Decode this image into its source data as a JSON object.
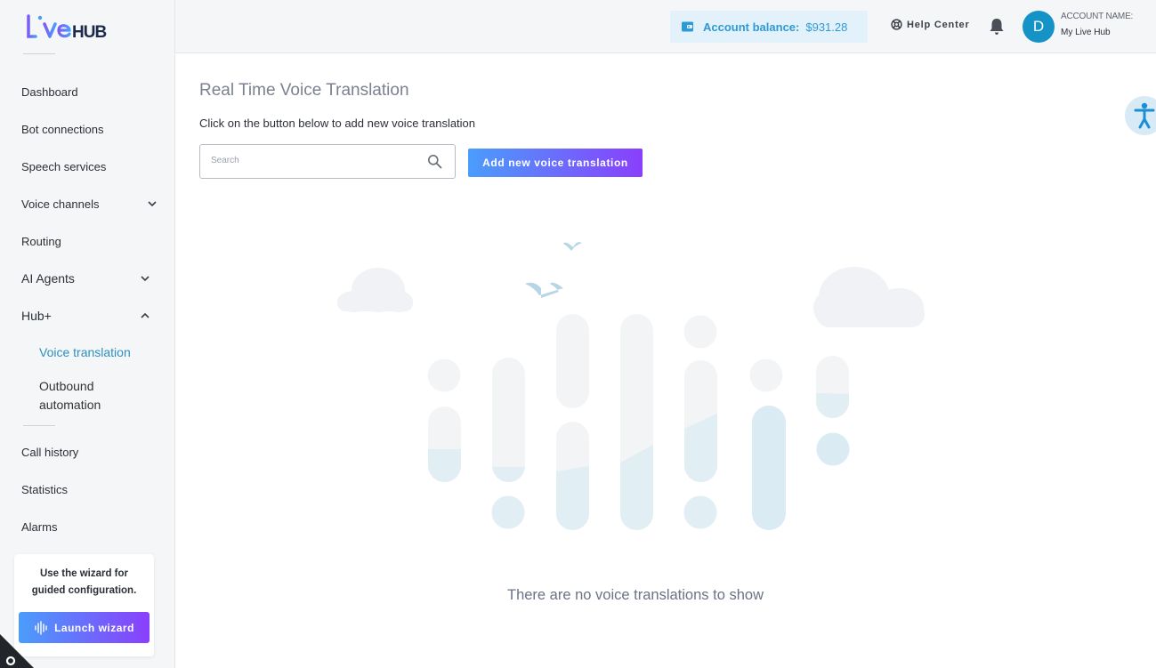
{
  "brand": {
    "logo_text": "LiveHUB"
  },
  "sidebar": {
    "items": [
      {
        "label": "Dashboard"
      },
      {
        "label": "Bot connections"
      },
      {
        "label": "Speech services"
      },
      {
        "label": "Voice channels"
      },
      {
        "label": "Routing"
      },
      {
        "label": "AI Agents"
      },
      {
        "label": "Hub+"
      }
    ],
    "sub_items": [
      {
        "label": "Voice translation"
      },
      {
        "label": "Outbound automation"
      }
    ],
    "bottom_items": [
      {
        "label": "Call history"
      },
      {
        "label": "Statistics"
      },
      {
        "label": "Alarms"
      }
    ],
    "wizard": {
      "text": "Use the wizard for guided configuration.",
      "button_label": "Launch wizard"
    }
  },
  "header": {
    "balance_label": "Account balance:",
    "balance_amount": "$931.28",
    "help_label": "Help Center",
    "avatar_initial": "D",
    "account_label": "ACCOUNT NAME:",
    "account_name": "My Live Hub"
  },
  "main": {
    "title": "Real Time Voice Translation",
    "subtitle": "Click on the button below to add new voice translation",
    "search_placeholder": "Search",
    "add_button_label": "Add new voice translation",
    "empty_message": "There are no voice translations to show"
  },
  "colors": {
    "accent_blue": "#4a9dfb",
    "accent_purple": "#8a3ffc",
    "active_link": "#2d8fbf",
    "avatar_bg": "#1593c7"
  }
}
